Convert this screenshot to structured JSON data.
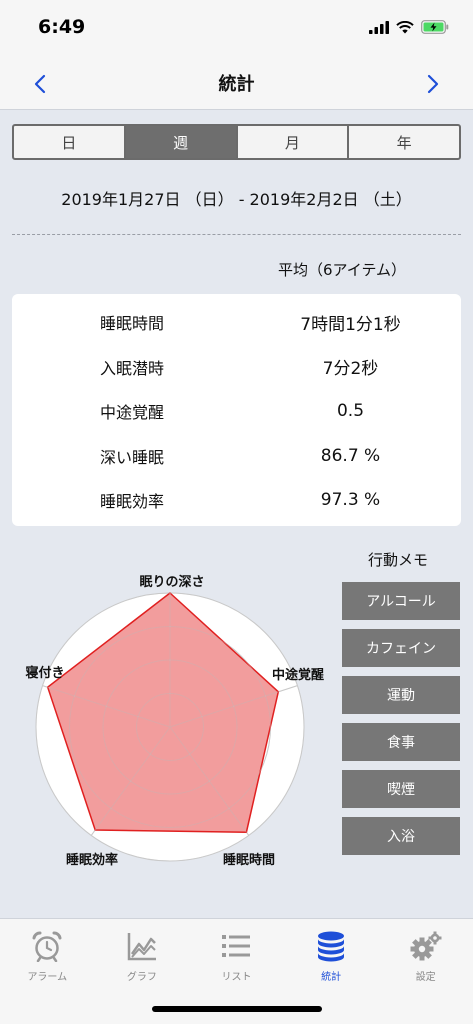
{
  "status_bar": {
    "time": "6:49"
  },
  "nav": {
    "title": "統計"
  },
  "segments": [
    {
      "label": "日",
      "active": false
    },
    {
      "label": "週",
      "active": true
    },
    {
      "label": "月",
      "active": false
    },
    {
      "label": "年",
      "active": false
    }
  ],
  "date_range": "2019年1月27日 （日） - 2019年2月2日 （土）",
  "average_label": "平均（6アイテム）",
  "stats": [
    {
      "label": "睡眠時間",
      "value": "7時間1分1秒"
    },
    {
      "label": "入眠潜時",
      "value": "7分2秒"
    },
    {
      "label": "中途覚醒",
      "value": "0.5"
    },
    {
      "label": "深い睡眠",
      "value": "86.7 %"
    },
    {
      "label": "睡眠効率",
      "value": "97.3 %"
    }
  ],
  "chart_data": {
    "type": "radar",
    "axes": [
      "眠りの深さ",
      "中途覚醒",
      "睡眠時間",
      "睡眠効率",
      "寝付き"
    ],
    "values": [
      1.0,
      0.85,
      0.97,
      0.95,
      0.96
    ],
    "max": 1.0,
    "rings": 4,
    "fill_color": "#f08c8c",
    "stroke_color": "#e02020"
  },
  "memo": {
    "title": "行動メモ",
    "items": [
      "アルコール",
      "カフェイン",
      "運動",
      "食事",
      "喫煙",
      "入浴"
    ]
  },
  "tabs": [
    {
      "label": "アラーム",
      "icon": "alarm-clock-icon",
      "active": false
    },
    {
      "label": "グラフ",
      "icon": "line-graph-icon",
      "active": false
    },
    {
      "label": "リスト",
      "icon": "list-icon",
      "active": false
    },
    {
      "label": "統計",
      "icon": "database-icon",
      "active": true
    },
    {
      "label": "設定",
      "icon": "gear-icon",
      "active": false
    }
  ],
  "colors": {
    "accent": "#1e4fd8",
    "inactive": "#888888"
  }
}
